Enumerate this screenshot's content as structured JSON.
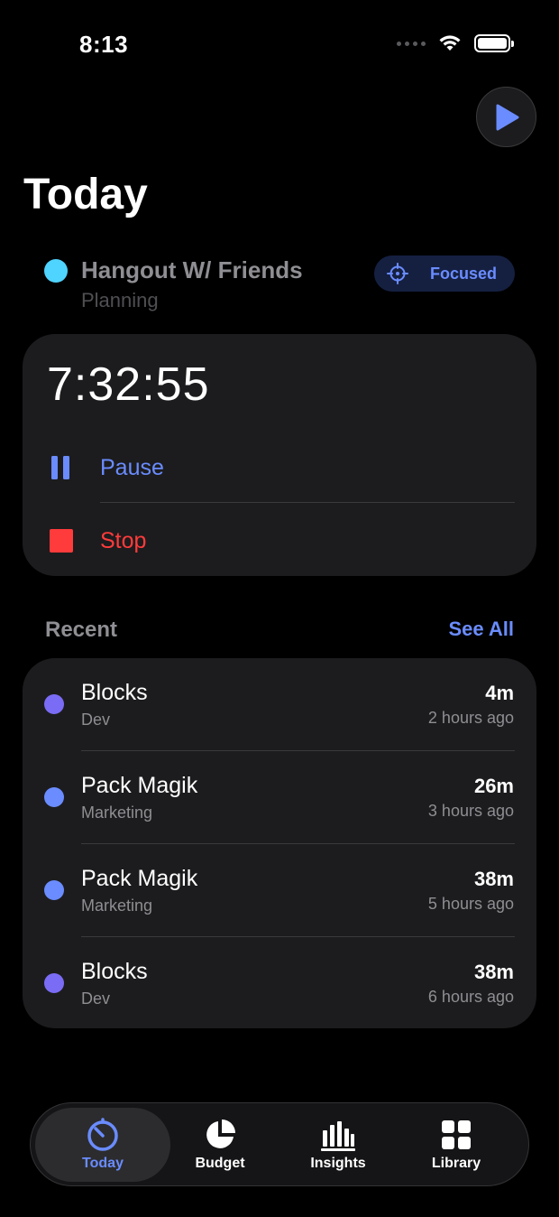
{
  "status_bar": {
    "time": "8:13"
  },
  "header": {
    "title": "Today"
  },
  "current": {
    "title": "Hangout W/ Friends",
    "category": "Planning",
    "color": "#4fd3ff",
    "focused_label": "Focused"
  },
  "timer": {
    "value": "7:32:55",
    "pause_label": "Pause",
    "stop_label": "Stop"
  },
  "recent": {
    "header": "Recent",
    "see_all": "See All",
    "items": [
      {
        "title": "Blocks",
        "category": "Dev",
        "duration": "4m",
        "ago": "2 hours ago",
        "color": "#7b6cf6"
      },
      {
        "title": "Pack Magik",
        "category": "Marketing",
        "duration": "26m",
        "ago": "3 hours ago",
        "color": "#6a8cff"
      },
      {
        "title": "Pack Magik",
        "category": "Marketing",
        "duration": "38m",
        "ago": "5 hours ago",
        "color": "#6a8cff"
      },
      {
        "title": "Blocks",
        "category": "Dev",
        "duration": "38m",
        "ago": "6 hours ago",
        "color": "#7b6cf6"
      }
    ]
  },
  "tabs": [
    {
      "label": "Today",
      "icon": "timer-icon",
      "active": true
    },
    {
      "label": "Budget",
      "icon": "pie-chart-icon",
      "active": false
    },
    {
      "label": "Insights",
      "icon": "bar-chart-icon",
      "active": false
    },
    {
      "label": "Library",
      "icon": "grid-icon",
      "active": false
    }
  ],
  "colors": {
    "accent": "#6a8cff",
    "stop": "#ff3b3b",
    "card": "#1c1c1e",
    "background": "#000000"
  }
}
